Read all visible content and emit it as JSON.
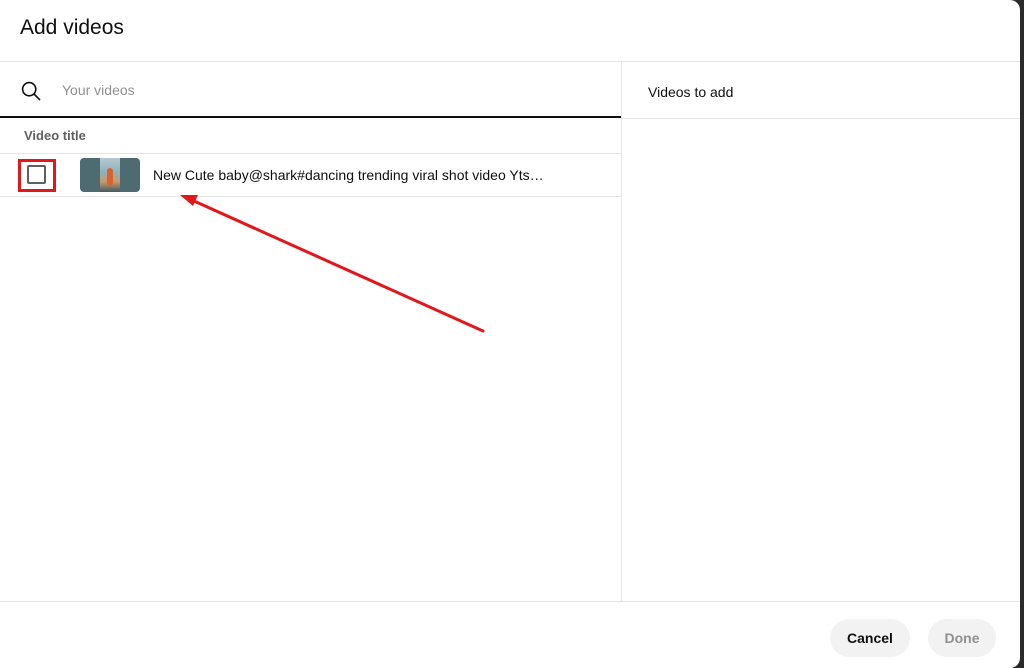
{
  "dialog": {
    "title": "Add videos"
  },
  "search": {
    "placeholder": "Your videos",
    "value": ""
  },
  "table": {
    "column_header": "Video title",
    "rows": [
      {
        "title": "New Cute baby@shark#dancing trending viral shot video Yts…",
        "checked": false
      }
    ]
  },
  "right_pane": {
    "header": "Videos to add"
  },
  "footer": {
    "cancel_label": "Cancel",
    "done_label": "Done"
  },
  "colors": {
    "annotation_red": "#e3161b",
    "primary_text": "#0f0f0f",
    "secondary_text": "#606060",
    "disabled_text": "#909090",
    "button_bg": "#f2f2f2"
  },
  "icons": {
    "search": "search-icon"
  }
}
